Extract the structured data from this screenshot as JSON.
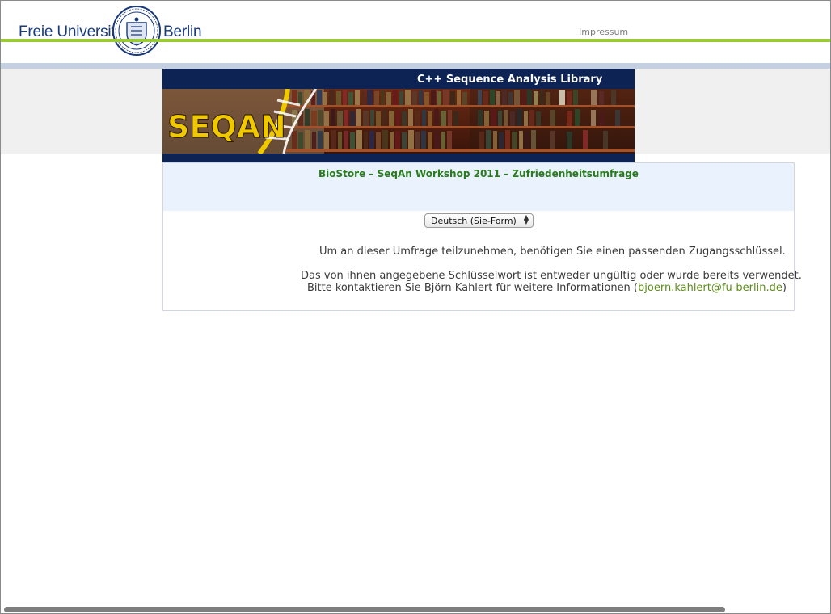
{
  "header": {
    "brand_left": "Freie Universität",
    "brand_right": "Berlin",
    "seal_icon": "fu-berlin-seal",
    "impressum_link": "Impressum",
    "colors": {
      "green_line": "#99cc33",
      "blue_line": "#c5cfe2",
      "brand_text": "#1a3a7a"
    }
  },
  "banner": {
    "title": "C++ Sequence Analysis Library",
    "logo_text": "SEQAN",
    "image": "library-bookshelf"
  },
  "survey": {
    "title": "BioStore – SeqAn Workshop 2011 – Zufriedenheitsumfrage",
    "language_select": {
      "selected": "Deutsch (Sie-Form)"
    },
    "message_line1": "Um an dieser Umfrage teilzunehmen, benötigen Sie einen passenden Zugangsschlüssel.",
    "message_line2": "Das von ihnen angegebene Schlüsselwort ist entweder ungültig oder wurde bereits verwendet.",
    "message_line3_prefix": "Bitte kontaktieren Sie Björn Kahlert für weitere Informationen (",
    "contact_email": "bjoern.kahlert@fu-berlin.de",
    "message_line3_suffix": ")",
    "colors": {
      "title": "#2a7a1e",
      "link": "#5e8c1a",
      "head_bg": "#eaf2fe"
    }
  }
}
